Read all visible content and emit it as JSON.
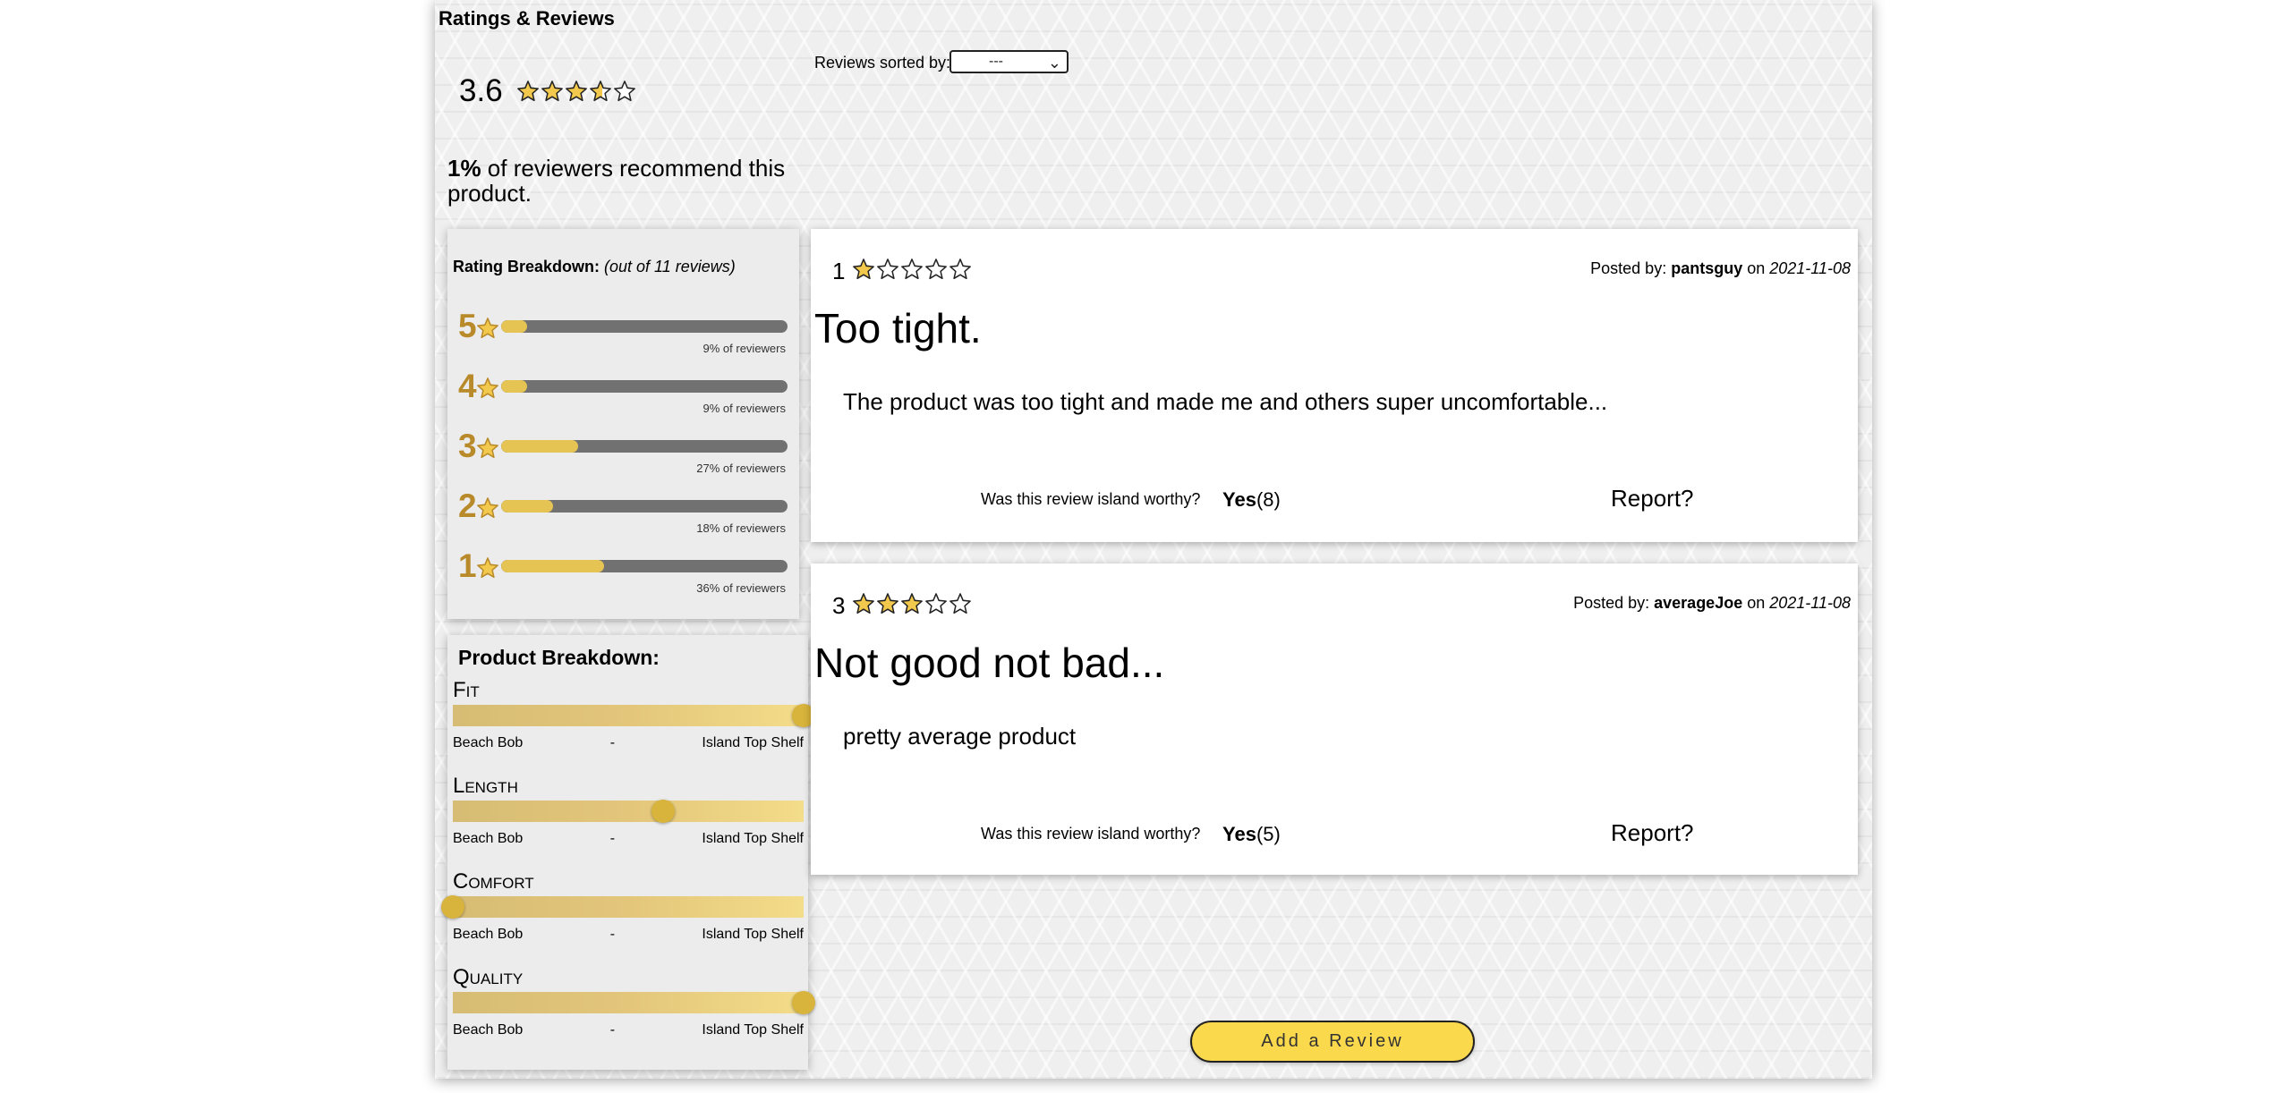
{
  "header": {
    "title": "Ratings & Reviews"
  },
  "summary": {
    "average": "3.6",
    "average_stars": 3.6,
    "recommend_pct": "1%",
    "recommend_text": " of reviewers recommend this product."
  },
  "breakdown": {
    "label": "Rating Breakdown:",
    "count_text": "(out of 11 reviews)",
    "rows": [
      {
        "stars": "5",
        "pct_label": "9% of reviewers",
        "pct": 9
      },
      {
        "stars": "4",
        "pct_label": "9% of reviewers",
        "pct": 9
      },
      {
        "stars": "3",
        "pct_label": "27% of reviewers",
        "pct": 27
      },
      {
        "stars": "2",
        "pct_label": "18% of reviewers",
        "pct": 18
      },
      {
        "stars": "1",
        "pct_label": "36% of reviewers",
        "pct": 36
      }
    ]
  },
  "product_breakdown": {
    "title": "Product Breakdown:",
    "factors": [
      {
        "name": "Fit",
        "value": 1.0,
        "low": "Beach Bob",
        "mid": "-",
        "high": "Island Top Shelf"
      },
      {
        "name": "Length",
        "value": 0.6,
        "low": "Beach Bob",
        "mid": "-",
        "high": "Island Top Shelf"
      },
      {
        "name": "Comfort",
        "value": 0.0,
        "low": "Beach Bob",
        "mid": "-",
        "high": "Island Top Shelf"
      },
      {
        "name": "Quality",
        "value": 1.0,
        "low": "Beach Bob",
        "mid": "-",
        "high": "Island Top Shelf"
      }
    ]
  },
  "sort": {
    "label": "Reviews sorted by:",
    "selected": "---"
  },
  "reviews": [
    {
      "rating": "1",
      "rating_value": 1,
      "posted_prefix": "Posted by: ",
      "user": "pantsguy",
      "on": " on ",
      "date": "2021-11-08",
      "title": "Too tight.",
      "body": "The product was too tight and made me and others super uncomfortable...",
      "worthy": "Was this review island worthy?",
      "yes": "Yes",
      "yes_count": "(8)",
      "report": "Report?"
    },
    {
      "rating": "3",
      "rating_value": 3,
      "posted_prefix": "Posted by: ",
      "user": "averageJoe",
      "on": " on ",
      "date": "2021-11-08",
      "title": "Not good not bad...",
      "body": "pretty average product",
      "worthy": "Was this review island worthy?",
      "yes": "Yes",
      "yes_count": "(5)",
      "report": "Report?"
    }
  ],
  "actions": {
    "add_review": "Add a Review"
  },
  "colors": {
    "star_fill": "#f2c94c",
    "star_outline": "#222222",
    "button": "#fbd94c",
    "rating_number": "#b88a2a"
  }
}
